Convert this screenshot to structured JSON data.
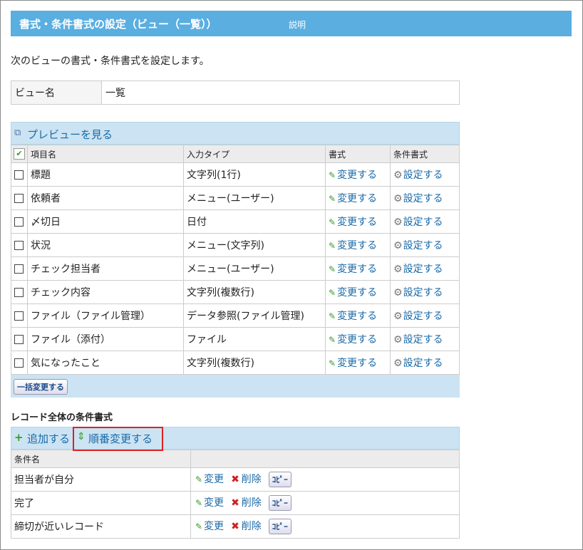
{
  "header": {
    "title": "書式・条件書式の設定（ビュー（一覧））",
    "help": "説明"
  },
  "description": "次のビューの書式・条件書式を設定します。",
  "view_name": {
    "label": "ビュー名",
    "value": "一覧"
  },
  "preview_link": "プレビューを見る",
  "columns": {
    "item": "項目名",
    "input_type": "入力タイプ",
    "format": "書式",
    "conditional": "条件書式"
  },
  "rows": [
    {
      "name": "標題",
      "type": "文字列(1行)"
    },
    {
      "name": "依頼者",
      "type": "メニュー(ユーザー)"
    },
    {
      "name": "〆切日",
      "type": "日付"
    },
    {
      "name": "状況",
      "type": "メニュー(文字列)"
    },
    {
      "name": "チェック担当者",
      "type": "メニュー(ユーザー)"
    },
    {
      "name": "チェック内容",
      "type": "文字列(複数行)"
    },
    {
      "name": "ファイル（ファイル管理）",
      "type": "データ参照(ファイル管理)"
    },
    {
      "name": "ファイル（添付）",
      "type": "ファイル"
    },
    {
      "name": "気になったこと",
      "type": "文字列(複数行)"
    }
  ],
  "change_label": "変更する",
  "set_label": "設定する",
  "bulk_change": "一括変更する",
  "record_section": {
    "title": "レコード全体の条件書式",
    "add": "追加する",
    "reorder": "順番変更する",
    "column": "条件名",
    "rows": [
      "担当者が自分",
      "完了",
      "締切が近いレコード"
    ],
    "edit": "変更",
    "delete": "削除",
    "copy": "ｺﾋﾟｰ"
  }
}
